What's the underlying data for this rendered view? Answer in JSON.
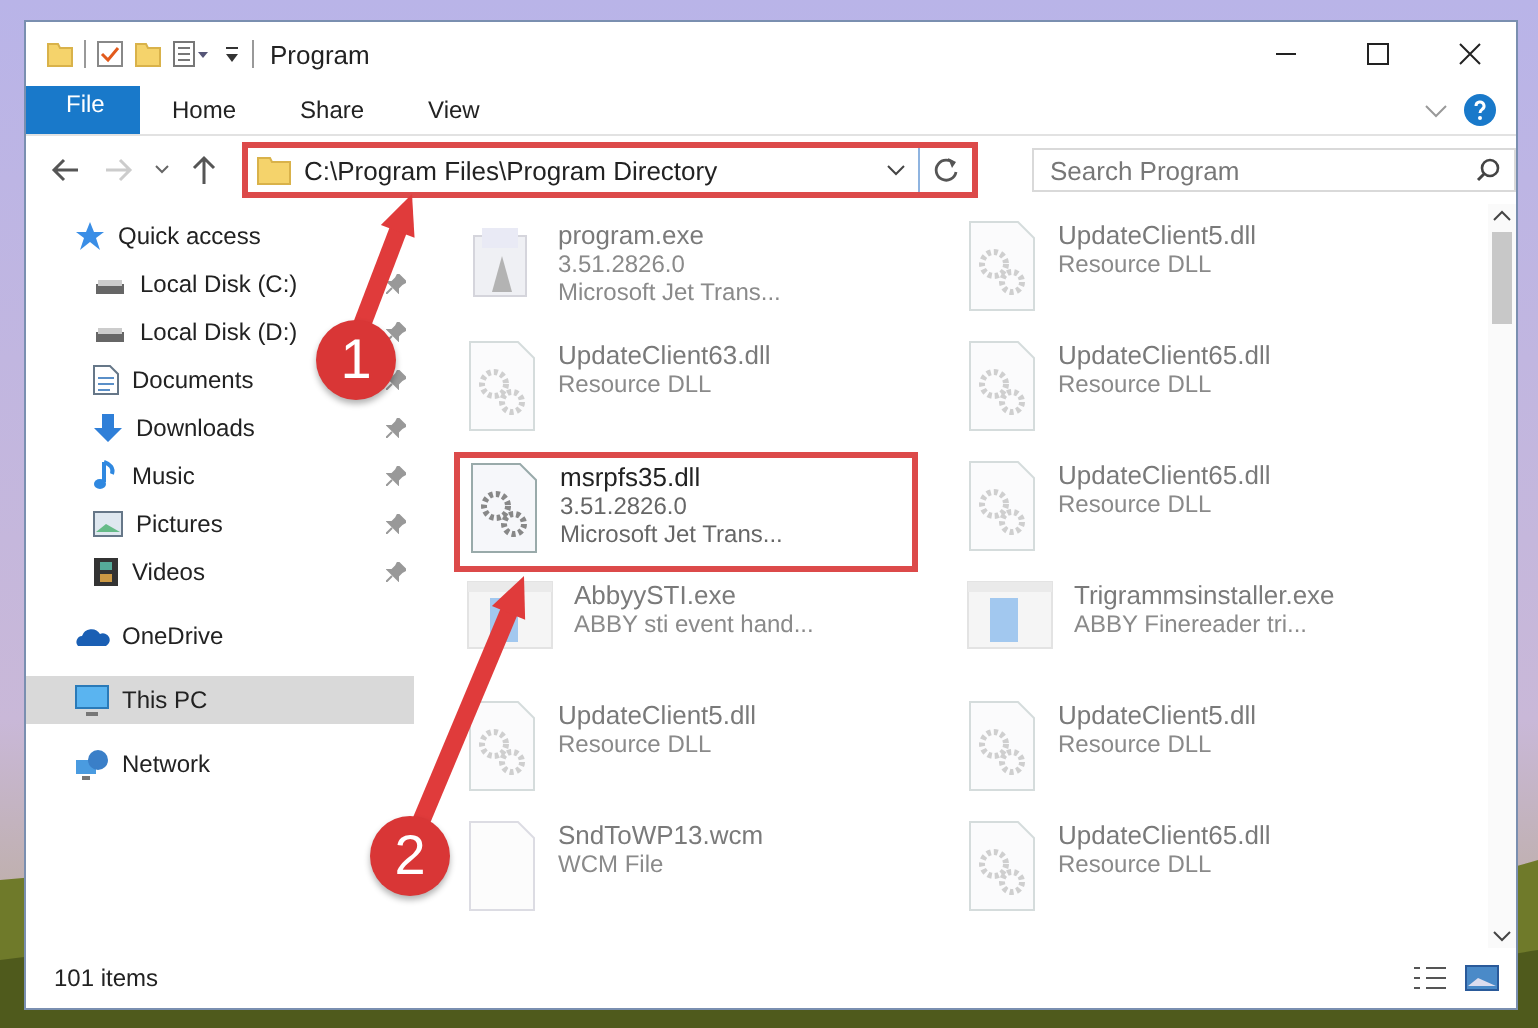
{
  "window": {
    "title": "Program"
  },
  "ribbon_tabs": [
    {
      "label": "File",
      "kind": "file"
    },
    {
      "label": "Home",
      "kind": "tab"
    },
    {
      "label": "Share",
      "kind": "tab"
    },
    {
      "label": "View",
      "kind": "tab"
    }
  ],
  "address": {
    "path": "C:\\Program Files\\Program Directory",
    "highlighted": true
  },
  "search": {
    "placeholder": "Search Program"
  },
  "sidebar": {
    "items": [
      {
        "label": "Quick access",
        "kind": "star",
        "selected": false,
        "children": [
          {
            "label": "Local Disk (C:)",
            "kind": "disk",
            "pinned": true,
            "selected": false
          },
          {
            "label": "Local Disk (D:)",
            "kind": "disk",
            "pinned": true,
            "selected": false
          },
          {
            "label": "Documents",
            "kind": "documents",
            "pinned": true,
            "selected": false
          },
          {
            "label": "Downloads",
            "kind": "downloads",
            "pinned": true,
            "selected": false
          },
          {
            "label": "Music",
            "kind": "music",
            "pinned": true,
            "selected": false
          },
          {
            "label": "Pictures",
            "kind": "pictures",
            "pinned": true,
            "selected": false
          },
          {
            "label": "Videos",
            "kind": "videos",
            "pinned": true,
            "selected": false
          }
        ]
      },
      {
        "label": "OneDrive",
        "kind": "cloud",
        "selected": false
      },
      {
        "label": "This PC",
        "kind": "pc",
        "selected": true
      },
      {
        "label": "Network",
        "kind": "network",
        "selected": false
      }
    ]
  },
  "files": [
    {
      "name": "program.exe",
      "line_2": "3.51.2826.0",
      "line_3": "Microsoft Jet Trans...",
      "kind": "installer",
      "faded": true,
      "highlighted": false
    },
    {
      "name": "UpdateClient5.dll",
      "line_2": "Resource DLL",
      "kind": "dll",
      "faded": true,
      "highlighted": false
    },
    {
      "name": "UpdateClient63.dll",
      "line_2": "Resource DLL",
      "kind": "dll",
      "faded": true,
      "highlighted": false
    },
    {
      "name": "UpdateClient65.dll",
      "line_2": "Resource DLL",
      "kind": "dll",
      "faded": true,
      "highlighted": false
    },
    {
      "name": "msrpfs35.dll",
      "line_2": "3.51.2826.0",
      "line_3": "Microsoft Jet Trans...",
      "kind": "dll",
      "faded": false,
      "highlighted": true
    },
    {
      "name": "UpdateClient65.dll",
      "line_2": "Resource DLL",
      "kind": "dll",
      "faded": true,
      "highlighted": false
    },
    {
      "name": "AbbyySTI.exe",
      "line_2": "ABBY sti event hand...",
      "kind": "exe",
      "faded": true,
      "highlighted": false
    },
    {
      "name": "Trigrammsinstaller.exe",
      "line_2": "ABBY Finereader tri...",
      "kind": "exe",
      "faded": true,
      "highlighted": false
    },
    {
      "name": "UpdateClient5.dll",
      "line_2": "Resource DLL",
      "kind": "dll",
      "faded": true,
      "highlighted": false
    },
    {
      "name": "UpdateClient5.dll",
      "line_2": "Resource DLL",
      "kind": "dll",
      "faded": true,
      "highlighted": false
    },
    {
      "name": "SndToWP13.wcm",
      "line_2": "WCM File",
      "kind": "file",
      "faded": true,
      "highlighted": false
    },
    {
      "name": "UpdateClient65.dll",
      "line_2": "Resource DLL",
      "kind": "dll",
      "faded": true,
      "highlighted": false
    }
  ],
  "status_bar": {
    "count": "101 items"
  },
  "annotations": [
    {
      "number": "1"
    },
    {
      "number": "2"
    }
  ]
}
